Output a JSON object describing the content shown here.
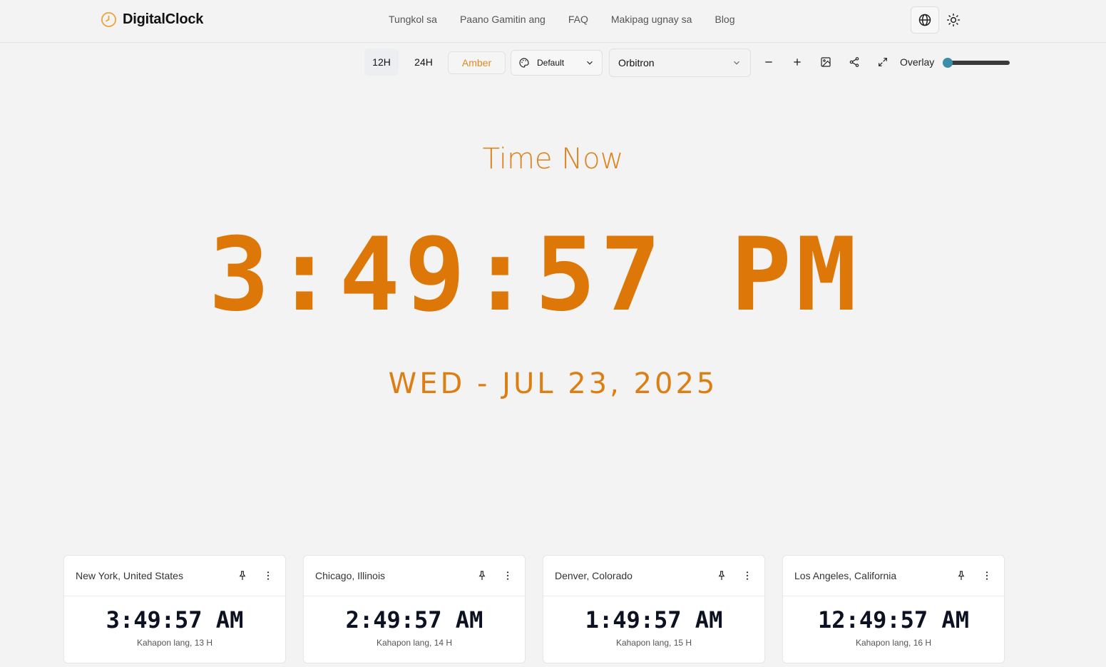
{
  "header": {
    "brand": "DigitalClock",
    "nav": [
      "Tungkol sa",
      "Paano Gamitin ang",
      "FAQ",
      "Makipag ugnay sa",
      "Blog"
    ]
  },
  "toolbar": {
    "format_12": "12H",
    "format_24": "24H",
    "color_label": "Amber",
    "theme_select": "Default",
    "font_select": "Orbitron",
    "overlay_label": "Overlay",
    "overlay_value": 0
  },
  "main": {
    "title": "Time Now",
    "time": "3:49:57 PM",
    "date": "WED - JUL 23, 2025"
  },
  "cards": [
    {
      "city": "New York, United States",
      "time": "3:49:57 AM",
      "diff": "Kahapon lang, 13 H"
    },
    {
      "city": "Chicago, Illinois",
      "time": "2:49:57 AM",
      "diff": "Kahapon lang, 14 H"
    },
    {
      "city": "Denver, Colorado",
      "time": "1:49:57 AM",
      "diff": "Kahapon lang, 15 H"
    },
    {
      "city": "Los Angeles, California",
      "time": "12:49:57 AM",
      "diff": "Kahapon lang, 16 H"
    }
  ],
  "colors": {
    "accent": "#dc7708",
    "background": "#f3f3f3",
    "slider_thumb": "#3c8ea8"
  },
  "icons": {
    "logo": "clock-icon",
    "language": "globe-icon",
    "theme": "sun-icon",
    "palette": "palette-icon",
    "zoom_out": "minus-icon",
    "zoom_in": "plus-icon",
    "image": "image-icon",
    "share": "share-icon",
    "fullscreen": "expand-icon",
    "pin": "pin-icon",
    "more": "more-vertical-icon"
  }
}
